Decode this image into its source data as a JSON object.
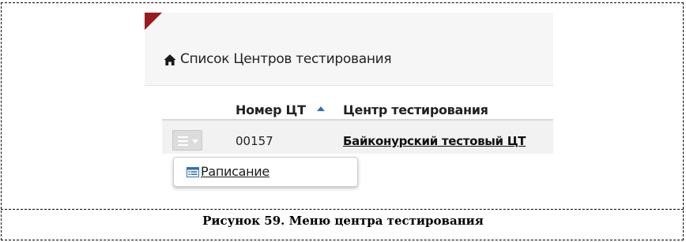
{
  "header": {
    "title": "Список Центров тестирования",
    "home_icon": "home-icon"
  },
  "table": {
    "columns": [
      "Номер ЦТ",
      "Центр тестирования"
    ],
    "sort_icon": "sort-ascending-icon",
    "rows": [
      {
        "number": "00157",
        "name": "Байконурский тестовый ЦТ"
      }
    ]
  },
  "row_menu": {
    "button_icon": "hamburger-menu-icon",
    "items": [
      {
        "label": "Раписание",
        "icon": "list-icon"
      }
    ]
  },
  "colors": {
    "accent_corner": "#9a1b1f",
    "sort_arrow": "#2f6fb5",
    "menu_item_icon": "#2f6fb5"
  },
  "caption": "Рисунок 59. Меню центра тестирования"
}
